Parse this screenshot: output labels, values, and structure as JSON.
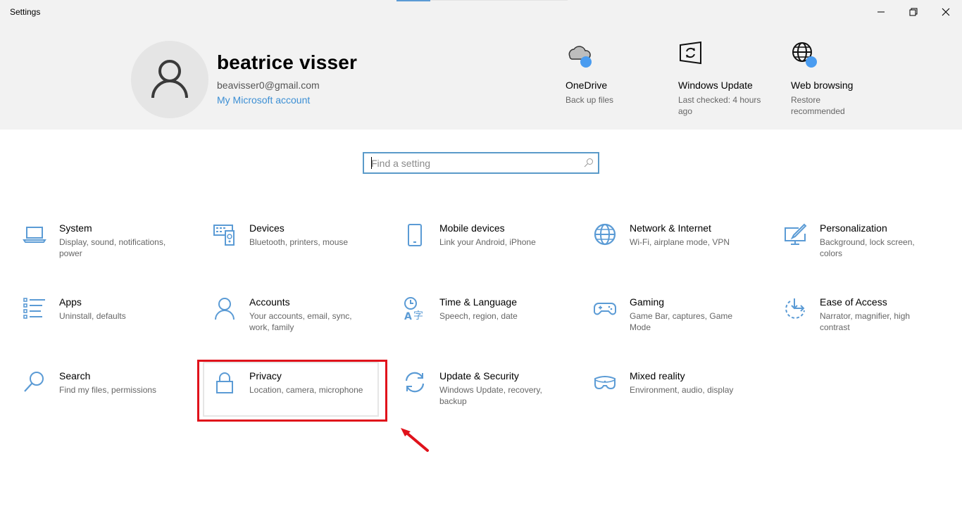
{
  "window": {
    "title": "Settings",
    "controls": {
      "minimize": "minimize-icon",
      "maximize": "restore-icon",
      "close": "close-icon"
    }
  },
  "profile": {
    "name": "beatrice visser",
    "email": "beavisser0@gmail.com",
    "account_link": "My Microsoft account"
  },
  "quick_status": [
    {
      "title": "OneDrive",
      "subtitle": "Back up files",
      "icon": "onedrive-cloud-icon"
    },
    {
      "title": "Windows Update",
      "subtitle": "Last checked: 4 hours ago",
      "icon": "windows-update-icon"
    },
    {
      "title": "Web browsing",
      "subtitle": "Restore recommended",
      "icon": "globe-icon"
    }
  ],
  "search": {
    "placeholder": "Find a setting",
    "value": ""
  },
  "categories": [
    {
      "title": "System",
      "subtitle": "Display, sound, notifications, power",
      "icon": "laptop-icon"
    },
    {
      "title": "Devices",
      "subtitle": "Bluetooth, printers, mouse",
      "icon": "keyboard-speaker-icon"
    },
    {
      "title": "Mobile devices",
      "subtitle": "Link your Android, iPhone",
      "icon": "phone-icon"
    },
    {
      "title": "Network & Internet",
      "subtitle": "Wi-Fi, airplane mode, VPN",
      "icon": "globe-icon"
    },
    {
      "title": "Personalization",
      "subtitle": "Background, lock screen, colors",
      "icon": "paintbrush-monitor-icon"
    },
    {
      "title": "Apps",
      "subtitle": "Uninstall, defaults",
      "icon": "list-icon"
    },
    {
      "title": "Accounts",
      "subtitle": "Your accounts, email, sync, work, family",
      "icon": "person-icon"
    },
    {
      "title": "Time & Language",
      "subtitle": "Speech, region, date",
      "icon": "time-language-icon"
    },
    {
      "title": "Gaming",
      "subtitle": "Game Bar, captures, Game Mode",
      "icon": "gamepad-icon"
    },
    {
      "title": "Ease of Access",
      "subtitle": "Narrator, magnifier, high contrast",
      "icon": "ease-of-access-icon"
    },
    {
      "title": "Search",
      "subtitle": "Find my files, permissions",
      "icon": "magnifier-icon"
    },
    {
      "title": "Privacy",
      "subtitle": "Location, camera, microphone",
      "icon": "lock-icon"
    },
    {
      "title": "Update & Security",
      "subtitle": "Windows Update, recovery, backup",
      "icon": "sync-arrows-icon"
    },
    {
      "title": "Mixed reality",
      "subtitle": "Environment, audio, display",
      "icon": "vr-headset-icon"
    }
  ],
  "annotation": {
    "highlighted": "Privacy",
    "color": "#e0121b"
  },
  "colors": {
    "accent": "#3c8fd4",
    "icon_blue": "#5b9bd5",
    "header_bg": "#f2f2f2",
    "status_dot": "#4a9cf0"
  }
}
